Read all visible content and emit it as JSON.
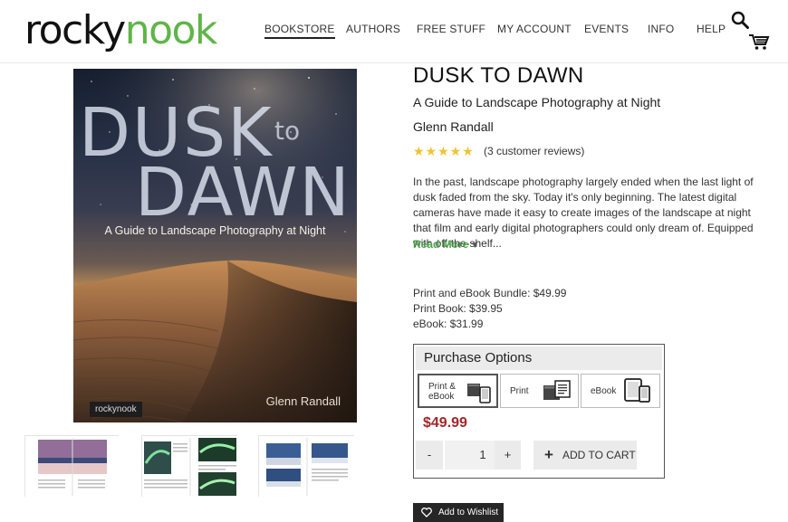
{
  "logo": {
    "part1": "rocky",
    "part2": "nook"
  },
  "nav": {
    "bookstore": "BOOKSTORE",
    "authors": "AUTHORS",
    "free_stuff": "FREE STUFF",
    "my_account": "MY ACCOUNT",
    "events": "EVENTS",
    "info": "INFO",
    "help": "HELP"
  },
  "icons": {
    "search": "search-icon",
    "cart": "cart-icon",
    "heart": "heart-icon",
    "print_ebook": "book-and-phone-icon",
    "print": "book-icon",
    "ebook": "tablet-phone-icon"
  },
  "cover": {
    "title_word1": "DUSK",
    "title_to": "to",
    "title_word2": "DAWN",
    "subtitle": "A Guide to Landscape Photography at Night",
    "author": "Glenn Randall",
    "publisher": "rockynook"
  },
  "product": {
    "title": "DUSK TO DAWN",
    "subtitle": "A Guide to Landscape Photography at Night",
    "author": "Glenn Randall",
    "stars": "★★★★★",
    "reviews": "(3 customer reviews)",
    "description": "In the past, landscape photography largely ended when the last light of dusk faded from the sky. Today it's only beginning. The latest digital cameras have made it easy to create images of the landscape at night that film and early digital photographers could only dream of. Equipped with off-the-shelf...",
    "read_more": "Read More",
    "read_more_arrow": "▼"
  },
  "prices": {
    "bundle": "Print and eBook Bundle: $49.99",
    "print": "Print Book: $39.95",
    "ebook": "eBook: $31.99"
  },
  "purchase": {
    "heading": "Purchase Options",
    "option_bundle_line1": "Print &",
    "option_bundle_line2": "eBook",
    "option_print": "Print",
    "option_ebook": "eBook",
    "selected_price": "$49.99",
    "minus": "-",
    "quantity": "1",
    "plus": "+",
    "add_to_cart": "ADD TO CART",
    "add_plus": "+"
  },
  "wishlist": {
    "label": "Add to Wishlist"
  },
  "colors": {
    "brand_green": "#5fb548",
    "price_red": "#a3262b",
    "read_more_green": "#4aa64a",
    "star_gold": "#f2c230"
  }
}
